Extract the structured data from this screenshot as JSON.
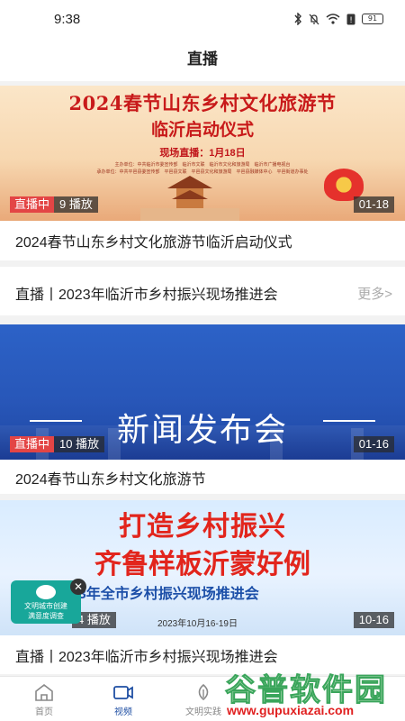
{
  "status_bar": {
    "time": "9:38",
    "battery": "91"
  },
  "header": {
    "title": "直播"
  },
  "cards": [
    {
      "banner": {
        "title_line1": "2024春节山东乡村文化旅游节",
        "title_line2": "临沂启动仪式",
        "live_text": "现场直播：1月18日",
        "organizer_line1": "主办单位：中共临沂市委宣传部　临沂市文联　临沂市文化和旅游局　临沂市广播电视台",
        "organizer_line2": "承办单位：中共平邑县委宣传部　平邑县文联　平邑县文化和旅游局　平邑县融媒体中心　平邑街道办事处"
      },
      "live_badge": "直播中",
      "play_count": "9  播放",
      "date": "01-18",
      "title": "2024春节山东乡村文化旅游节临沂启动仪式"
    },
    {
      "title": "直播丨2023年临沂市乡村振兴现场推进会",
      "more": "更多>"
    },
    {
      "banner": {
        "text": "新闻发布会"
      },
      "live_badge": "直播中",
      "play_count": "10  播放",
      "date": "01-16",
      "title": "2024春节山东乡村文化旅游节"
    },
    {
      "banner": {
        "line1": "打造乡村振兴",
        "line2": "齐鲁样板沂蒙好例",
        "line3": "23年全市乡村振兴现场推进会",
        "date": "2023年10月16-19日"
      },
      "play_count": "4  播放",
      "date": "10-16",
      "title": "直播丨2023年临沂市乡村振兴现场推进会"
    }
  ],
  "float_badge": {
    "line1": "文明城市创建",
    "line2": "满意度调查",
    "close": "✕"
  },
  "tabbar": {
    "tabs": [
      {
        "label": "首页",
        "icon": "home-icon"
      },
      {
        "label": "视频",
        "icon": "video-icon"
      },
      {
        "label": "文明实践",
        "icon": "practice-icon"
      }
    ]
  },
  "watermark": {
    "main": "谷普软件园",
    "url": "www.gupuxiazai.com"
  }
}
